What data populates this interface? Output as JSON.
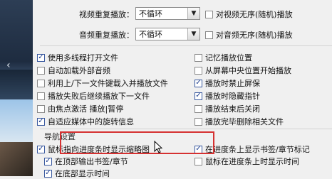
{
  "video_repeat": {
    "label": "视频重复播放：",
    "value": "不循环",
    "option": "对视频无序(随机)播放"
  },
  "audio_repeat": {
    "label": "音频重复播放：",
    "value": "不循环",
    "option": "对音频无序(随机)播放"
  },
  "left_options": [
    {
      "label": "使用多线程打开文件",
      "checked": true
    },
    {
      "label": "自动加载外部音频",
      "checked": false
    },
    {
      "label": "利用上/下一文件键载入并播放文件",
      "checked": false
    },
    {
      "label": "播放失败后继续播放下一文件",
      "checked": false
    },
    {
      "label": "由焦点激活 播放|暂停",
      "checked": false
    },
    {
      "label": "自适应媒体中的旋转信息",
      "checked": true
    }
  ],
  "right_options": [
    {
      "label": "记忆播放位置",
      "checked": false
    },
    {
      "label": "从屏幕中央位置开始播放",
      "checked": false
    },
    {
      "label": "播放时禁止屏保",
      "checked": true
    },
    {
      "label": "播放时隐藏指针",
      "checked": true
    },
    {
      "label": "播放结束后关闭",
      "checked": false
    },
    {
      "label": "播放完毕删除相关文件",
      "checked": false
    }
  ],
  "nav_section": {
    "title": "导航设置",
    "thumbnail_option": "鼠标指向进度条时显示缩略图",
    "top_bookmark": "在顶部输出书签/章节",
    "top_title": "在底部显示时间",
    "bookmark_marks": "在进度条上显示书签/章节标记",
    "hover_time": "鼠标在进度条上时显示时间"
  }
}
